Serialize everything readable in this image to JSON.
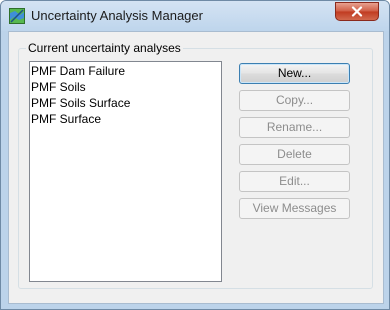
{
  "window": {
    "title": "Uncertainty Analysis Manager",
    "close_icon": "close-icon",
    "app_icon": "map-icon"
  },
  "group": {
    "label": "Current uncertainty analyses"
  },
  "analyses": [
    "PMF Dam Failure",
    "PMF Soils",
    "PMF Soils Surface",
    "PMF Surface"
  ],
  "buttons": {
    "new": "New...",
    "copy": "Copy...",
    "rename": "Rename...",
    "delete": "Delete",
    "edit": "Edit...",
    "view_messages": "View Messages"
  },
  "colors": {
    "close_button": "#c03a20",
    "disabled_text": "#8d8d8d"
  }
}
